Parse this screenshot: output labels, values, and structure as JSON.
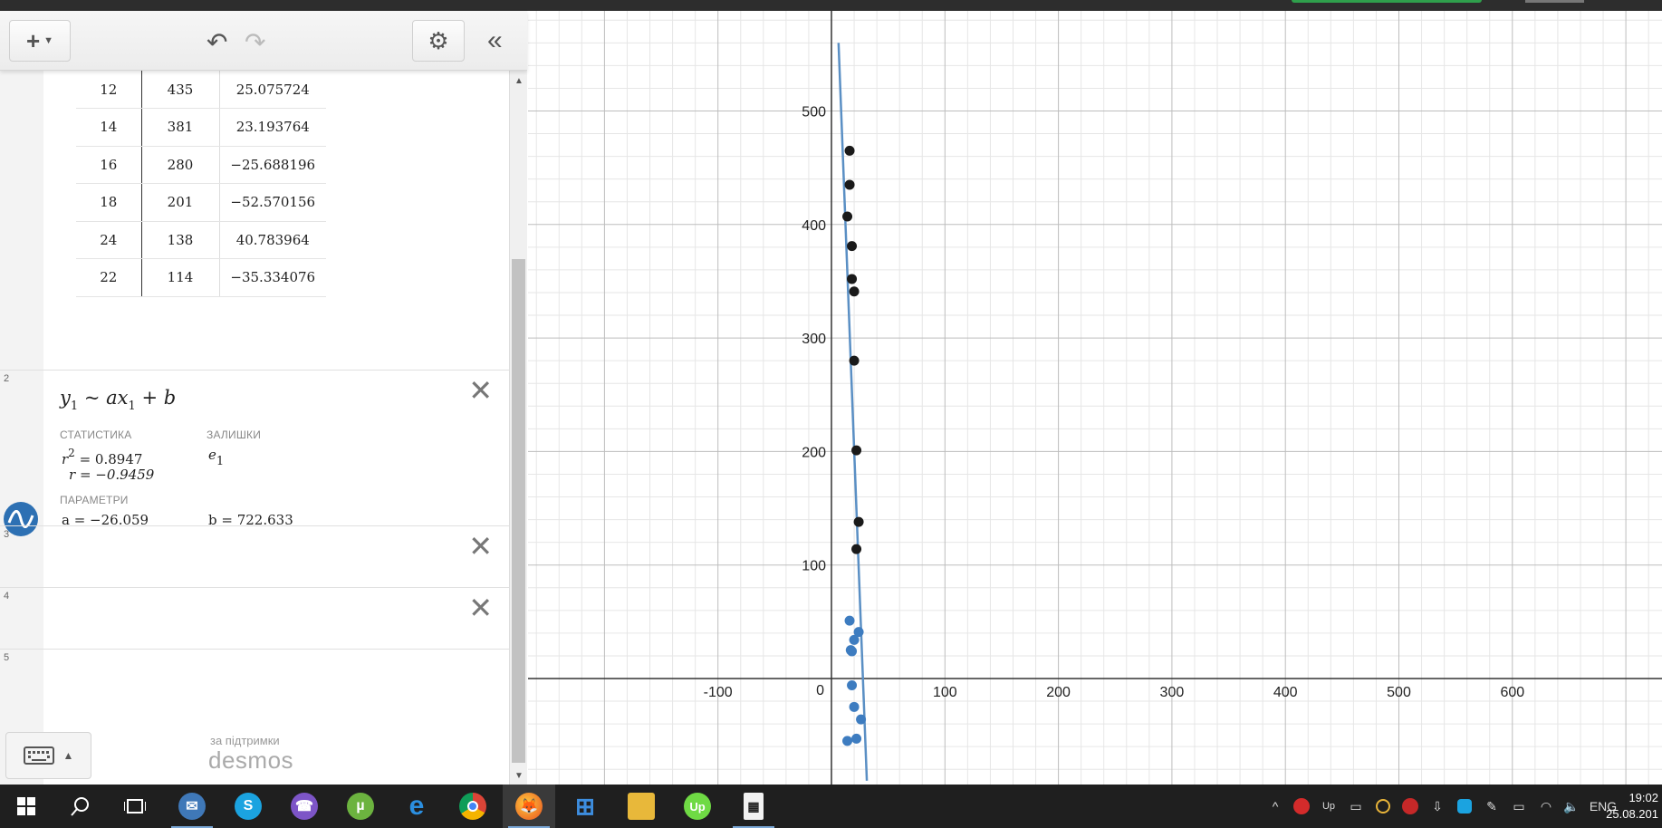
{
  "table": {
    "rows": [
      [
        "12",
        "435",
        "25.075724"
      ],
      [
        "14",
        "381",
        "23.193764"
      ],
      [
        "16",
        "280",
        "−25.688196"
      ],
      [
        "18",
        "201",
        "−52.570156"
      ],
      [
        "24",
        "138",
        "40.783964"
      ],
      [
        "22",
        "114",
        "−35.334076"
      ]
    ]
  },
  "regression": {
    "number": "2",
    "formula": {
      "y": "y",
      "sub1": "1",
      "tilde": " ~ ",
      "ax": "ax",
      "sub2": "1",
      "rest": " + b"
    },
    "stats_label": "СТАТИСТИКА",
    "residuals_label": "ЗАЛИШКИ",
    "r2_value": " = 0.8947",
    "r_value": "r = −0.9459",
    "residual_var": "e",
    "residual_sub": "1",
    "params_label": "ПАРАМЕТРИ",
    "a_value": "a = −26.059",
    "b_value": "b = 722.633"
  },
  "empty_rows": [
    "3",
    "4",
    "5"
  ],
  "footer": {
    "powered_by": "за підтримки",
    "brand": "desmos"
  },
  "graph": {
    "x_ticks": [
      "-100",
      "100",
      "200",
      "300",
      "400",
      "500",
      "600"
    ],
    "y_ticks": [
      "500",
      "400",
      "300",
      "200",
      "100"
    ],
    "origin_label": "0",
    "line": {
      "a": -26.059,
      "b": 722.633,
      "color": "#5a8fc4"
    },
    "black_points": [
      [
        16,
        465
      ],
      [
        16,
        435
      ],
      [
        14,
        407
      ],
      [
        18,
        381
      ],
      [
        18,
        352
      ],
      [
        20,
        341
      ],
      [
        20,
        280
      ],
      [
        22,
        201
      ],
      [
        24,
        138
      ],
      [
        22,
        114
      ]
    ],
    "blue_points": [
      [
        16,
        51
      ],
      [
        20,
        34
      ],
      [
        17,
        25
      ],
      [
        24,
        41
      ],
      [
        18,
        24
      ],
      [
        18,
        -6
      ],
      [
        20,
        -25
      ],
      [
        26,
        -36
      ],
      [
        22,
        -53
      ],
      [
        14,
        -55
      ]
    ],
    "black_color": "#1a1a1a",
    "blue_color": "#3d7cc0"
  },
  "taskbar": {
    "lang": "ENG",
    "time": "19:02",
    "date": "25.08.201"
  }
}
